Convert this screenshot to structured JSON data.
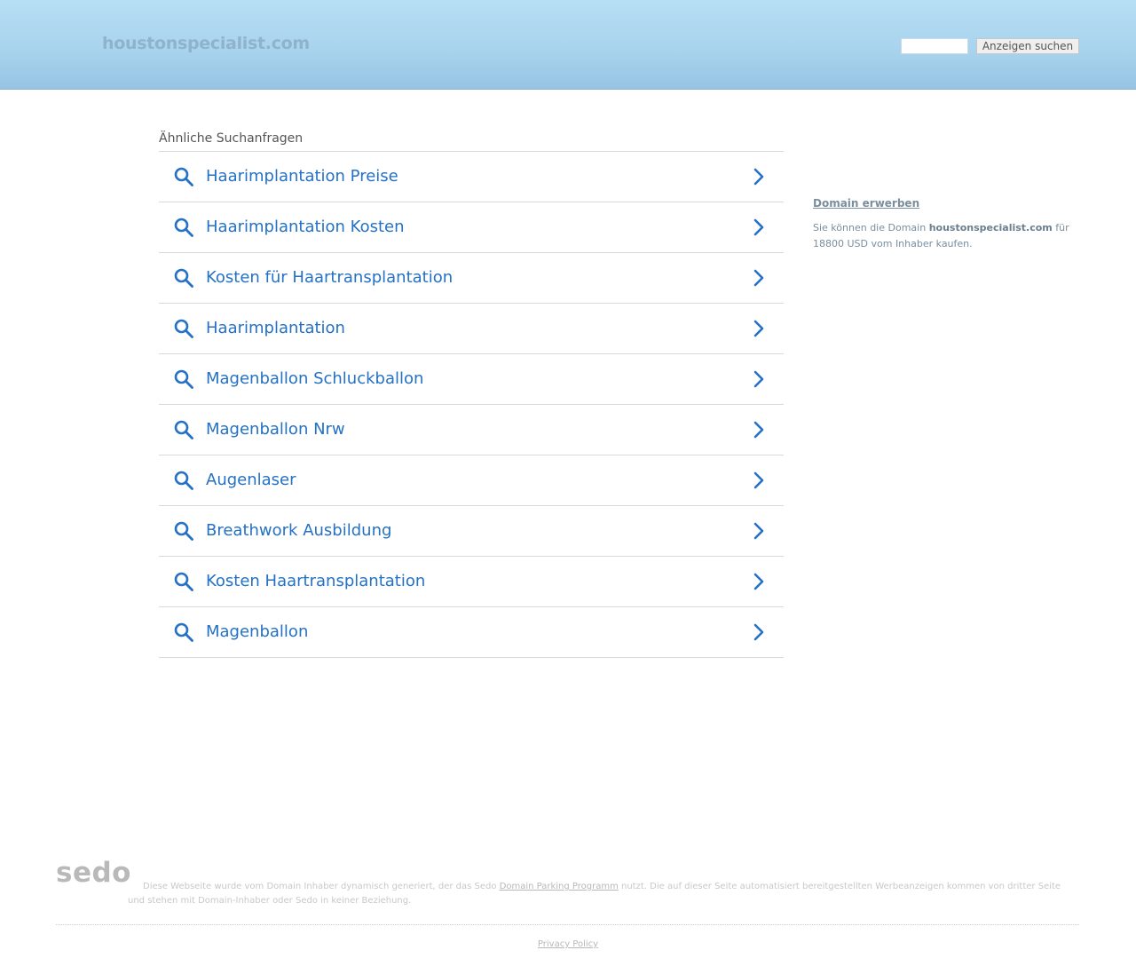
{
  "header": {
    "domain": "houstonspecialist.com",
    "search_value": "",
    "search_button": "Anzeigen suchen"
  },
  "related": {
    "heading": "Ähnliche Suchanfragen",
    "items": [
      {
        "label": "Haarimplantation Preise"
      },
      {
        "label": "Haarimplantation Kosten"
      },
      {
        "label": "Kosten für Haartransplantation"
      },
      {
        "label": "Haarimplantation"
      },
      {
        "label": "Magenballon Schluckballon"
      },
      {
        "label": "Magenballon Nrw"
      },
      {
        "label": "Augenlaser"
      },
      {
        "label": "Breathwork Ausbildung"
      },
      {
        "label": "Kosten Haartransplantation"
      },
      {
        "label": "Magenballon"
      }
    ],
    "item_icon": "search-icon",
    "item_arrow_icon": "chevron-right-icon"
  },
  "sidebar": {
    "buy_link": "Domain erwerben",
    "buy_text_prefix": "Sie können die Domain ",
    "buy_text_domain": "houstonspecialist.com",
    "buy_text_suffix": " für 18800 USD vom Inhaber kaufen."
  },
  "footer": {
    "logo": "sedo",
    "disclaimer_prefix": "Diese Webseite wurde vom Domain Inhaber dynamisch generiert, der das Sedo ",
    "disclaimer_link": "Domain Parking Programm",
    "disclaimer_suffix": " nutzt. Die auf dieser Seite automatisiert bereitgestellten Werbeanzeigen kommen von dritter Seite und stehen mit Domain-Inhaber oder Sedo in keiner Beziehung.",
    "privacy": "Privacy Policy"
  },
  "colors": {
    "accent": "#2471c5",
    "header_top": "#b7def4",
    "header_bottom": "#97c4e3",
    "sidebar_text": "#7a8e9e"
  }
}
